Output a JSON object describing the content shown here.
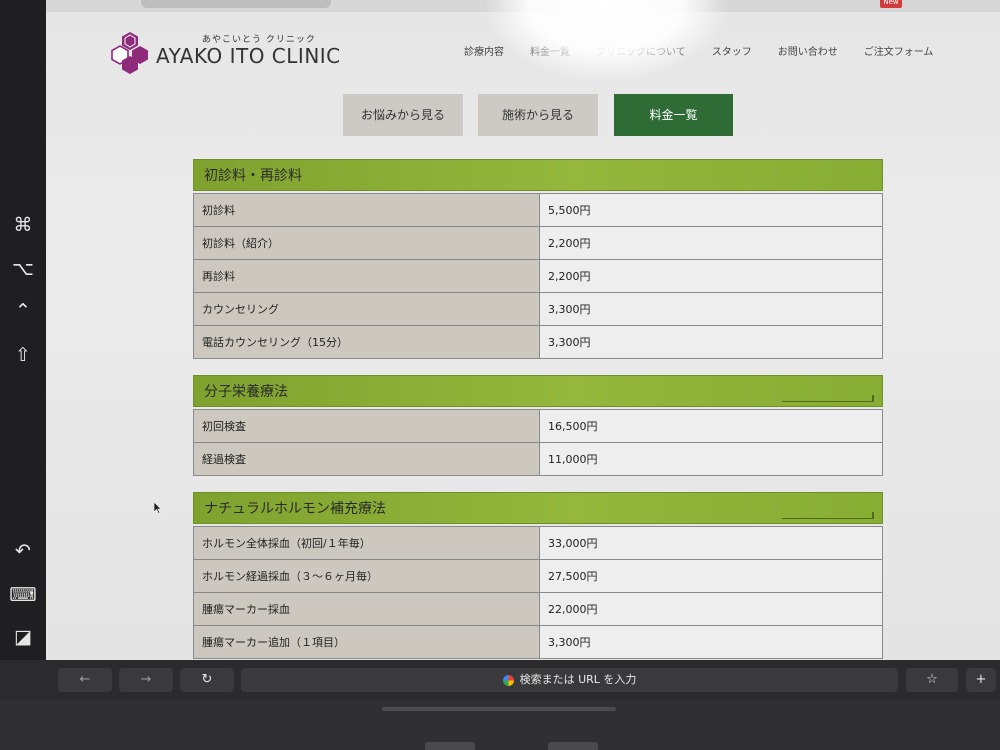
{
  "browser": {
    "new_badge": "New",
    "omnibox_text": "検索または URL を入力",
    "back_symbol": "←",
    "forward_symbol": "→",
    "reload_symbol": "↻",
    "bookmark_symbol": "☆",
    "add_symbol": "+"
  },
  "side_rail": {
    "icons": [
      {
        "name": "command-icon",
        "glyph": "⌘"
      },
      {
        "name": "option-icon",
        "glyph": "⌥"
      },
      {
        "name": "control-icon",
        "glyph": "⌃"
      },
      {
        "name": "shift-icon",
        "glyph": "⇧"
      },
      {
        "name": "undo-icon",
        "glyph": "↶"
      },
      {
        "name": "keyboard-icon",
        "glyph": "⌨"
      },
      {
        "name": "hide-sidebar-icon",
        "glyph": "◪"
      }
    ]
  },
  "header": {
    "logo_kana": "あやこいとう クリニック",
    "logo_text": "AYAKO ITO CLINIC",
    "nav": [
      "診療内容",
      "料金一覧",
      "クリニックについて",
      "スタッフ",
      "お問い合わせ",
      "ご注文フォーム"
    ]
  },
  "tabs": [
    {
      "label": "お悩みから見る",
      "active": false
    },
    {
      "label": "施術から見る",
      "active": false
    },
    {
      "label": "料金一覧",
      "active": true
    }
  ],
  "sections": [
    {
      "title": "初診料・再診料",
      "rows": [
        {
          "label": "初診料",
          "price": "5,500円"
        },
        {
          "label": "初診料（紹介）",
          "price": "2,200円"
        },
        {
          "label": "再診料",
          "price": "2,200円"
        },
        {
          "label": "カウンセリング",
          "price": "3,300円"
        },
        {
          "label": "電話カウンセリング（15分）",
          "price": "3,300円"
        }
      ]
    },
    {
      "title": "分子栄養療法",
      "rows": [
        {
          "label": "初回検査",
          "price": "16,500円"
        },
        {
          "label": "経過検査",
          "price": "11,000円"
        }
      ]
    },
    {
      "title": "ナチュラルホルモン補充療法",
      "rows": [
        {
          "label": "ホルモン全体採血（初回/１年毎）",
          "price": "33,000円"
        },
        {
          "label": "ホルモン経過採血（３〜６ヶ月毎）",
          "price": "27,500円"
        },
        {
          "label": "腫瘍マーカー採血",
          "price": "22,000円"
        },
        {
          "label": "腫瘍マーカー追加（１項目）",
          "price": "3,300円"
        }
      ]
    }
  ],
  "colors": {
    "section_header": "#88ad34",
    "active_tab": "#2f6b34",
    "logo_purple": "#8e2a7a"
  }
}
